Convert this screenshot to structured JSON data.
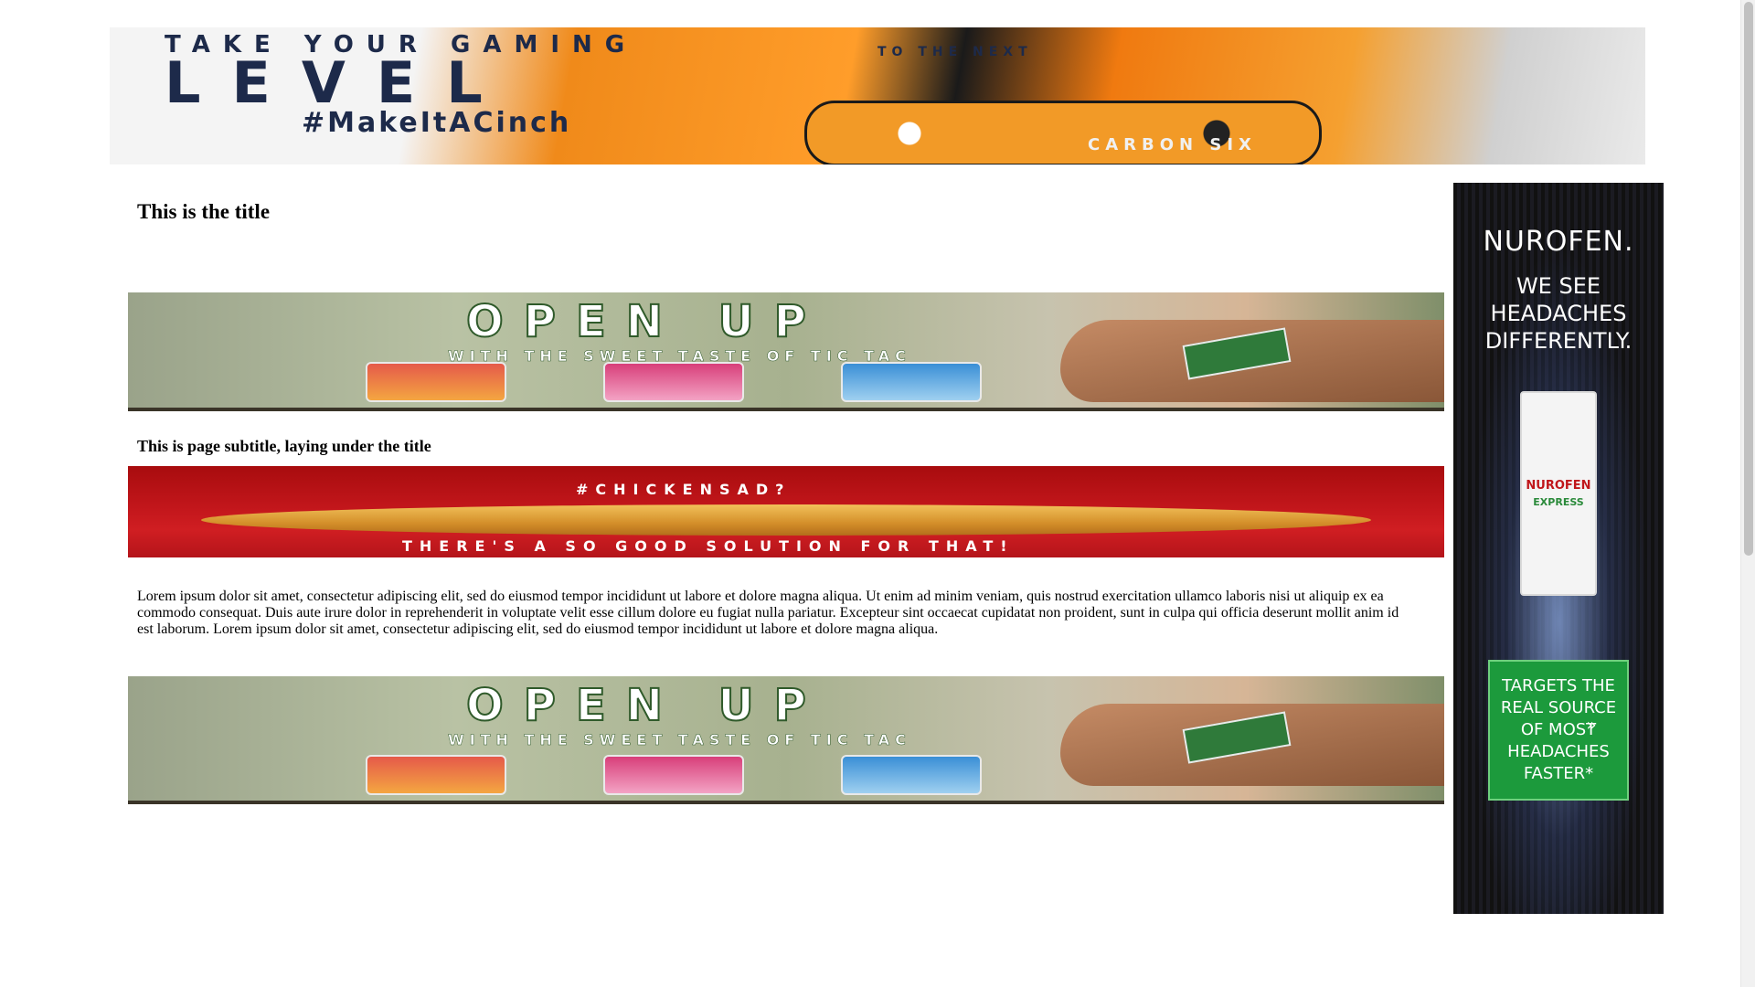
{
  "ads": {
    "gaming": {
      "headline_small": "TAKE YOUR GAMING",
      "headline_big": "LEVEL",
      "to_next": "TO THE NEXT",
      "hashtag": "#MakeItACinch",
      "brand": "CARBON SIX"
    },
    "tictac": {
      "headline": "OPEN UP",
      "subline": "WITH THE SWEET TASTE OF TIC TAC"
    },
    "chicken": {
      "hashtag": "#CHICKENSAD?",
      "line": "THERE'S A SO GOOD SOLUTION FOR THAT!"
    },
    "nurofen": {
      "brand": "NUROFEN.",
      "slogan": "WE SEE HEADACHES DIFFERENTLY.",
      "pack_name": "NUROFEN",
      "pack_sub": "EXPRESS",
      "cta": "TARGETS THE REAL SOURCE OF MOST HEADACHES FASTER*",
      "cta_arrow": "»"
    }
  },
  "page": {
    "title": "This is the title",
    "subtitle": "This is page subtitle, laying under the title",
    "body": "Lorem ipsum dolor sit amet, consectetur adipiscing elit, sed do eiusmod tempor incididunt ut labore et dolore magna aliqua. Ut enim ad minim veniam, quis nostrud exercitation ullamco laboris nisi ut aliquip ex ea commodo consequat. Duis aute irure dolor in reprehenderit in voluptate velit esse cillum dolore eu fugiat nulla pariatur. Excepteur sint occaecat cupidatat non proident, sunt in culpa qui officia deserunt mollit anim id est laborum. Lorem ipsum dolor sit amet, consectetur adipiscing elit, sed do eiusmod tempor incididunt ut labore et dolore magna aliqua."
  },
  "colors": {
    "gaming_orange": "#f29a27",
    "gaming_navy": "#1d2a4a",
    "chicken_red": "#c2161b",
    "nurofen_green": "#1c9a3c"
  }
}
